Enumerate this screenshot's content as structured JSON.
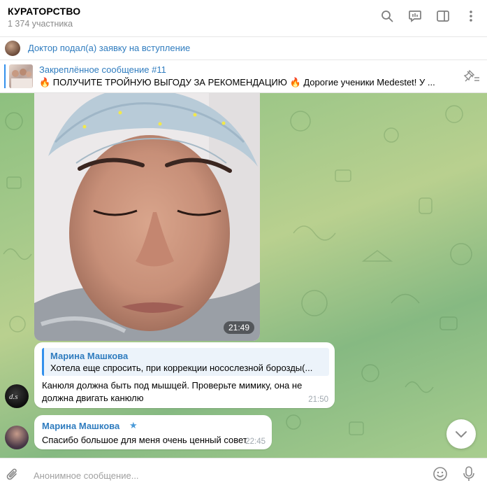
{
  "header": {
    "title": "КУРАТОРСТВО",
    "subtitle": "1 374 участника"
  },
  "join_bar": {
    "text": "Доктор подал(а) заявку на вступление"
  },
  "pinned": {
    "title": "Закреплённое сообщение #11",
    "text": "🔥 ПОЛУЧИТЕ ТРОЙНУЮ ВЫГОДУ ЗА РЕКОМЕНДАЦИЮ 🔥 Дорогие ученики Medestet! У ..."
  },
  "messages": {
    "photo_time": "21:49",
    "m1": {
      "reply_name": "Марина Машкова",
      "reply_text": "Хотела еще спросить, при коррекции носослезной борозды(...",
      "text": "Канюля должна быть под мышцей. Проверьте мимику, она не должна двигать канюлю",
      "time": "21:50"
    },
    "m2": {
      "name": "Марина Машкова",
      "star": "★",
      "text": "Спасибо большое для меня очень ценный совет",
      "time": "22:45"
    }
  },
  "composer": {
    "placeholder": "Анонимное сообщение..."
  },
  "icons": {
    "search": "search-icon",
    "discussion": "live-chat-icon",
    "sidebar": "sidebar-toggle-icon",
    "menu": "more-vertical-icon",
    "unpin": "unpin-icon",
    "attach": "paperclip-icon",
    "emoji": "smile-icon",
    "mic": "microphone-icon",
    "scroll": "chevron-down-icon"
  },
  "colors": {
    "accent": "#3390ec",
    "link": "#2f7cbf",
    "chat_bg": "#9cc889"
  }
}
